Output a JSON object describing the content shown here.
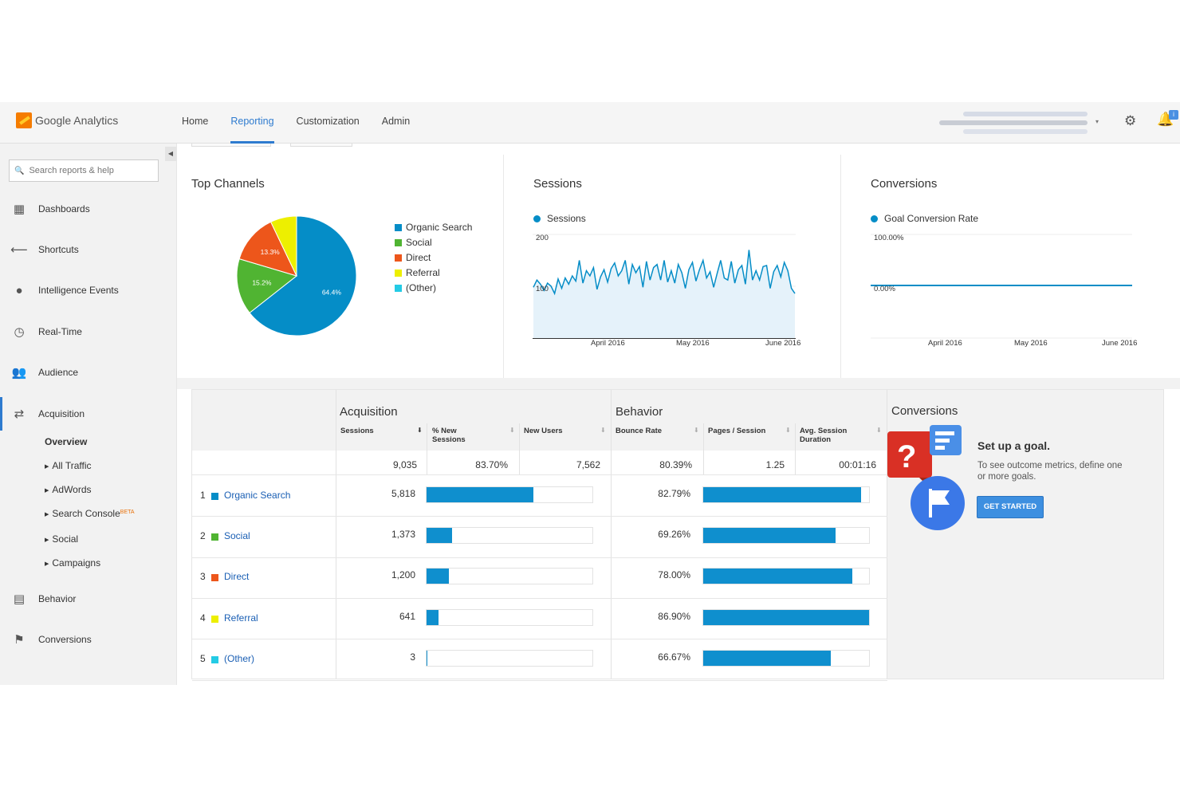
{
  "app": {
    "name": "Google Analytics"
  },
  "nav": {
    "home": "Home",
    "reporting": "Reporting",
    "customization": "Customization",
    "admin": "Admin"
  },
  "search": {
    "placeholder": "Search reports & help"
  },
  "sidebar": {
    "items": [
      {
        "label": "Dashboards",
        "icon": "grid-icon"
      },
      {
        "label": "Shortcuts",
        "icon": "arrow-shortcut-icon"
      },
      {
        "label": "Intelligence Events",
        "icon": "lightbulb-icon"
      },
      {
        "label": "Real-Time",
        "icon": "clock-icon"
      },
      {
        "label": "Audience",
        "icon": "people-icon"
      },
      {
        "label": "Acquisition",
        "icon": "arrows-icon"
      },
      {
        "label": "Behavior",
        "icon": "layout-icon"
      },
      {
        "label": "Conversions",
        "icon": "flag-icon"
      }
    ],
    "acquisition_sub": {
      "overview": "Overview",
      "all_traffic": "All Traffic",
      "adwords": "AdWords",
      "search_console": "Search Console",
      "search_console_badge": "BETA",
      "social": "Social",
      "campaigns": "Campaigns"
    }
  },
  "top_channels": {
    "title": "Top Channels",
    "legend": [
      "Organic Search",
      "Social",
      "Direct",
      "Referral",
      "(Other)"
    ],
    "slice_labels": [
      "64.4%",
      "15.2%",
      "13.3%"
    ]
  },
  "sessions_panel": {
    "title": "Sessions",
    "legend": "Sessions",
    "y_ticks": [
      "200",
      "100"
    ],
    "x_ticks": [
      "April 2016",
      "May 2016",
      "June 2016"
    ]
  },
  "conversions_panel": {
    "title": "Conversions",
    "legend": "Goal Conversion Rate",
    "y_ticks": [
      "100.00%",
      "0.00%"
    ],
    "x_ticks": [
      "April 2016",
      "May 2016",
      "June 2016"
    ]
  },
  "table": {
    "groups": {
      "acquisition": "Acquisition",
      "behavior": "Behavior",
      "conversions": "Conversions"
    },
    "columns": {
      "sessions": "Sessions",
      "new_sessions_1": "% New",
      "new_sessions_2": "Sessions",
      "new_users": "New Users",
      "bounce_rate": "Bounce Rate",
      "pages_session": "Pages / Session",
      "avg_duration_1": "Avg. Session",
      "avg_duration_2": "Duration"
    },
    "totals": {
      "sessions": "9,035",
      "new_sessions": "83.70%",
      "new_users": "7,562",
      "bounce_rate": "80.39%",
      "pages_session": "1.25",
      "avg_duration": "00:01:16"
    },
    "rows": [
      {
        "num": "1",
        "channel": "Organic Search",
        "sessions": "5,818",
        "bounce": "82.79%"
      },
      {
        "num": "2",
        "channel": "Social",
        "sessions": "1,373",
        "bounce": "69.26%"
      },
      {
        "num": "3",
        "channel": "Direct",
        "sessions": "1,200",
        "bounce": "78.00%"
      },
      {
        "num": "4",
        "channel": "Referral",
        "sessions": "641",
        "bounce": "86.90%"
      },
      {
        "num": "5",
        "channel": "(Other)",
        "sessions": "3",
        "bounce": "66.67%"
      }
    ]
  },
  "goal": {
    "title": "Set up a goal.",
    "description": "To see outcome metrics, define one or more goals.",
    "button": "GET STARTED"
  },
  "chart_data": [
    {
      "type": "pie",
      "title": "Top Channels",
      "categories": [
        "Organic Search",
        "Social",
        "Direct",
        "Referral",
        "(Other)"
      ],
      "values": [
        64.4,
        15.2,
        13.3,
        7.1,
        0.0
      ],
      "colors": [
        "#058dc7",
        "#50b432",
        "#ed561b",
        "#edef00",
        "#24cbe5"
      ]
    },
    {
      "type": "area",
      "title": "Sessions",
      "series": [
        {
          "name": "Sessions",
          "values": [
            98,
            112,
            104,
            92,
            106,
            100,
            86,
            114,
            96,
            116,
            104,
            120,
            110,
            150,
            106,
            130,
            120,
            136,
            94,
            118,
            132,
            108,
            134,
            145,
            120,
            130,
            150,
            104,
            142,
            126,
            138,
            98,
            148,
            112,
            136,
            142,
            112,
            150,
            108,
            130,
            106,
            142,
            126,
            96,
            132,
            146,
            110,
            132,
            150,
            116,
            128,
            98,
            125,
            150,
            116,
            112,
            148,
            106,
            132,
            140,
            104,
            170,
            112,
            130,
            112,
            138,
            140,
            96,
            128,
            140,
            118,
            146,
            130,
            96,
            86
          ]
        }
      ],
      "ylim": [
        0,
        200
      ],
      "x_ticks": [
        "April 2016",
        "May 2016",
        "June 2016"
      ],
      "color": "#058dc7"
    },
    {
      "type": "line",
      "title": "Conversions",
      "series": [
        {
          "name": "Goal Conversion Rate",
          "values": [
            0,
            0
          ]
        }
      ],
      "ylim": [
        0,
        100
      ],
      "x_ticks": [
        "April 2016",
        "May 2016",
        "June 2016"
      ],
      "color": "#058dc7"
    }
  ],
  "bars": {
    "new_sessions_fraction": [
      0.644,
      0.152,
      0.133,
      0.071,
      0.0003
    ],
    "bounce_fraction": [
      0.9527,
      0.797,
      0.8976,
      1.0,
      0.7672
    ]
  },
  "colors": {
    "accent": "#2e7bcf",
    "bar": "#0f8fce",
    "organic": "#058dc7",
    "social": "#50b432",
    "direct": "#ed561b",
    "referral": "#edef00",
    "other": "#24cbe5"
  }
}
